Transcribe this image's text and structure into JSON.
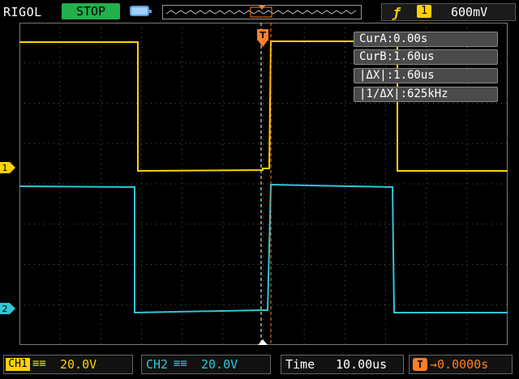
{
  "top_bar": {
    "brand": "RIGOL",
    "run_state": "STOP",
    "trigger": {
      "edge_icon": "rising-edge-icon",
      "channel": "1",
      "level": "600mV"
    }
  },
  "cursors": {
    "cur_a": "CurA:0.00s",
    "cur_b": "CurB:1.60us",
    "delta_x": "|ΔX|:1.60us",
    "inv_delta_x": "|1/ΔX|:625kHz"
  },
  "bottom_bar": {
    "ch1_label": "CH1",
    "ch1_coupling": "≡≡",
    "ch1_scale": "20.0V",
    "ch2_label": "CH2",
    "ch2_coupling": "≡≡",
    "ch2_scale": "20.0V",
    "time_label": "Time",
    "time_value": "10.00us",
    "offset_icon": "T",
    "offset_value": "→0.0000s"
  },
  "markers": {
    "ch1": "1",
    "ch2": "2"
  },
  "colors": {
    "ch1": "#ffd200",
    "ch2": "#31c6d8",
    "trigger": "#ff7f27",
    "run_state": "#22b14c"
  }
}
